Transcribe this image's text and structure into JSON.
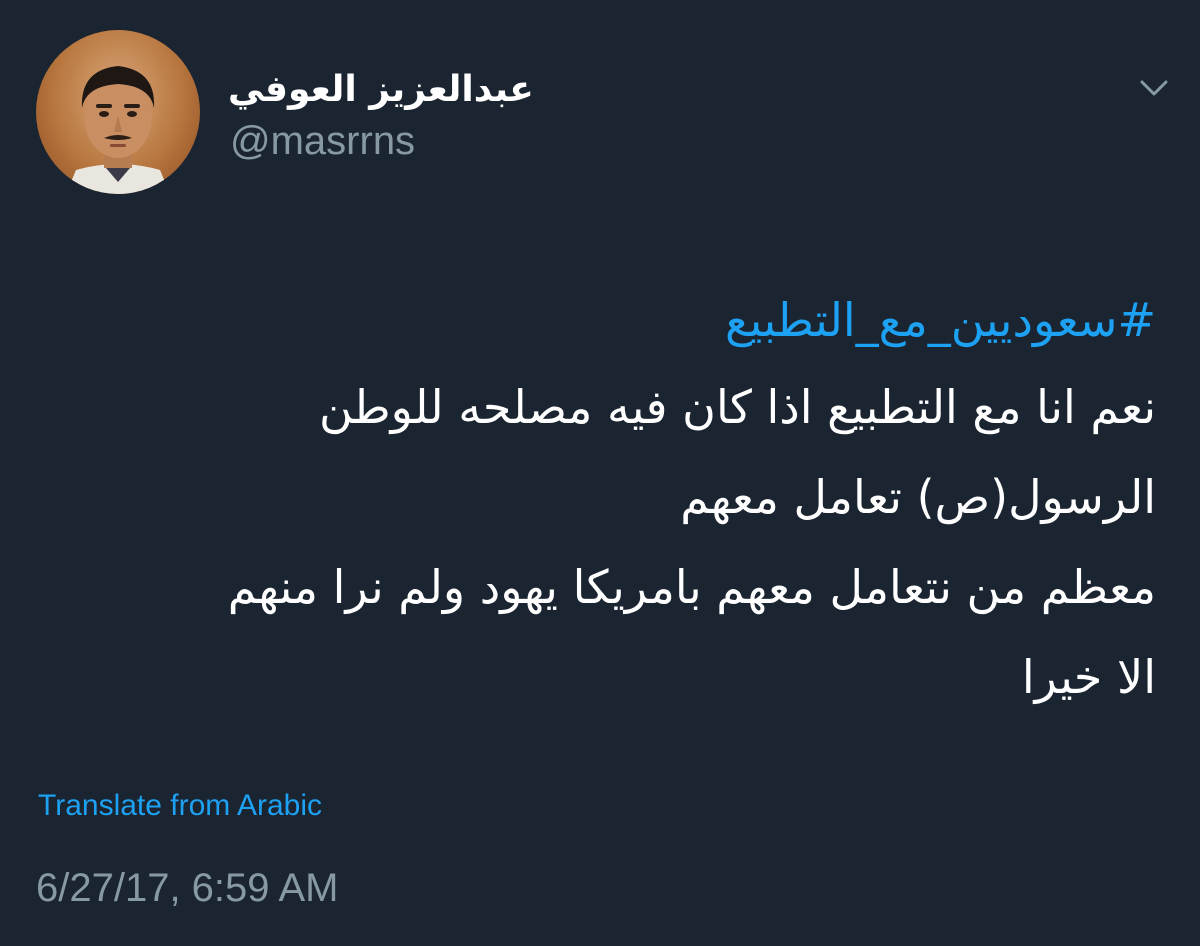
{
  "tweet": {
    "author": {
      "name": "عبدالعزيز العوفي",
      "handle": "@masrrns",
      "avatar_icon": "profile-photo"
    },
    "menu_icon": "chevron-down-icon",
    "hashtag": "#سعوديين_مع_التطبيع",
    "lines": [
      "نعم انا مع التطبيع اذا كان فيه مصلحه للوطن",
      "الرسول(ص) تعامل معهم",
      "معظم من نتعامل معهم بامريكا يهود ولم نرا منهم",
      "الا خيرا"
    ],
    "translate_label": "Translate from Arabic",
    "timestamp": "6/27/17, 6:59 AM",
    "colors": {
      "background": "#1b2431",
      "link": "#1da1f2",
      "muted": "#8899a6",
      "text": "#ffffff"
    }
  }
}
